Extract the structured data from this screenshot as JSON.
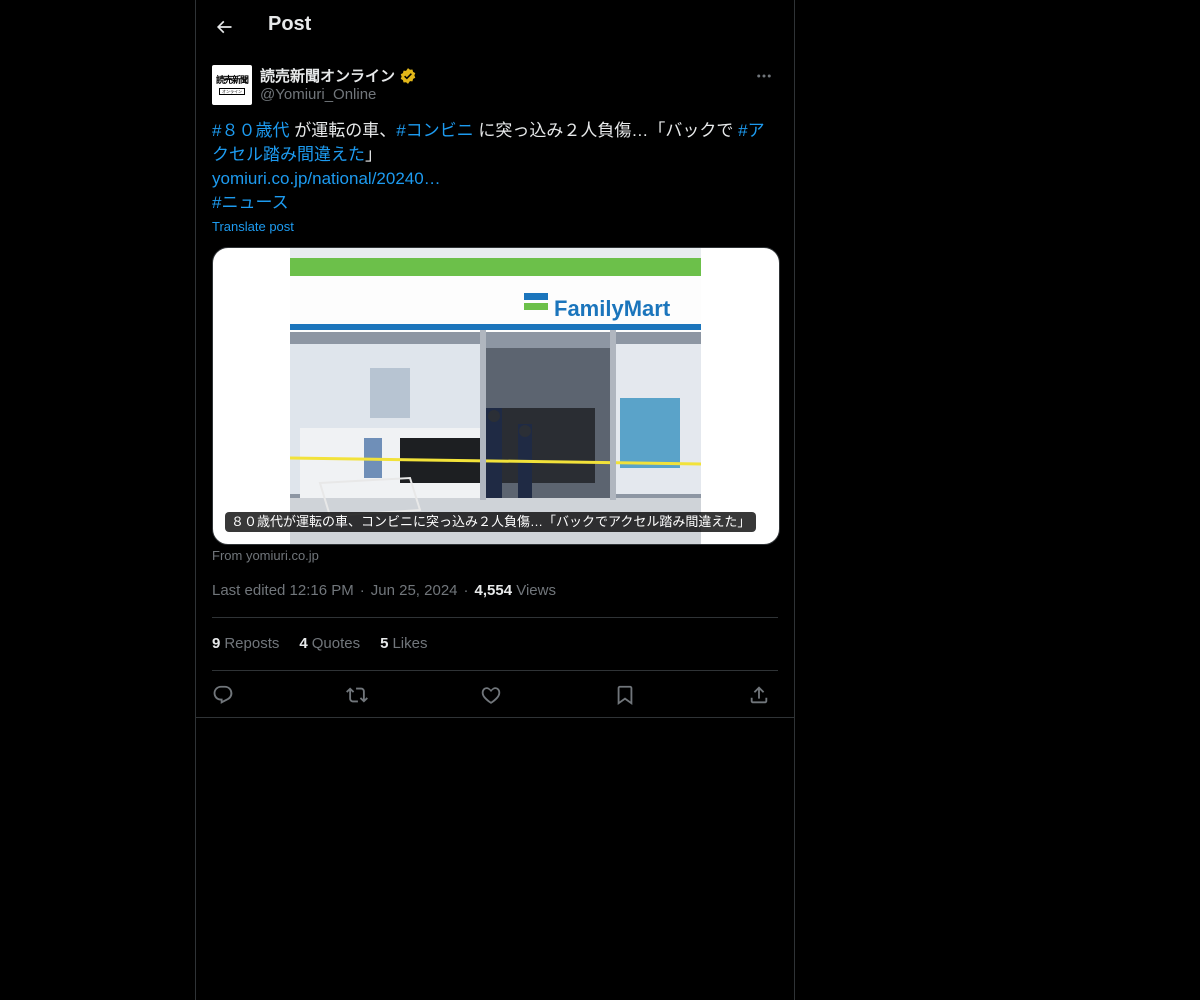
{
  "header": {
    "title": "Post"
  },
  "author": {
    "name": "読売新聞オンライン",
    "handle": "@Yomiuri_Online",
    "avatar_main": "読売新聞",
    "avatar_sub": "オンライン",
    "verified_color": "#e2b719"
  },
  "post": {
    "hashtag_1": "#８０歳代",
    "text_1": " が運転の車、",
    "hashtag_2": "#コンビニ",
    "text_2": " に突っ込み２人負傷…「バックで ",
    "hashtag_3": "#アクセル踏み間違えた",
    "text_3": "」",
    "link": "yomiuri.co.jp/national/20240…",
    "hashtag_4": "#ニュース",
    "translate": "Translate post"
  },
  "card": {
    "caption": "８０歳代が運転の車、コンビニに突っ込み２人負傷…「バックでアクセル踏み間違えた」",
    "store_name": "FamilyMart",
    "source": "From yomiuri.co.jp"
  },
  "meta": {
    "edited": "Last edited 12:16 PM",
    "date": "Jun 25, 2024",
    "views_count": "4,554",
    "views_label": "Views"
  },
  "stats": {
    "reposts_count": "9",
    "reposts_label": "Reposts",
    "quotes_count": "4",
    "quotes_label": "Quotes",
    "likes_count": "5",
    "likes_label": "Likes"
  },
  "colors": {
    "background": "#000000",
    "text": "#e7e9ea",
    "secondary": "#71767b",
    "accent": "#1d9bf0",
    "border": "#2f3336"
  },
  "icons": [
    "arrow-left-icon",
    "verified-badge-icon",
    "more-icon",
    "reply-icon",
    "repost-icon",
    "like-icon",
    "bookmark-icon",
    "share-icon"
  ]
}
